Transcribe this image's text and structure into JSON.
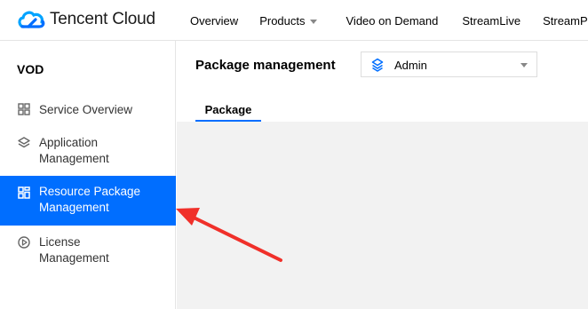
{
  "brand": {
    "name": "Tencent Cloud",
    "accent": "#006eff"
  },
  "nav": {
    "items": [
      "Overview",
      "Products",
      "Video on Demand",
      "StreamLive",
      "StreamPackage"
    ]
  },
  "sidebar": {
    "title": "VOD",
    "items": [
      {
        "lines": [
          "Service Overview"
        ],
        "icon": "grid-icon",
        "active": false
      },
      {
        "lines": [
          "Application",
          "Management"
        ],
        "icon": "layers-icon",
        "active": false
      },
      {
        "lines": [
          "Resource Package",
          "Management"
        ],
        "icon": "package-icon",
        "active": true
      },
      {
        "lines": [
          "License",
          "Management"
        ],
        "icon": "license-icon",
        "active": false
      }
    ]
  },
  "page": {
    "title": "Package management",
    "app_select": {
      "value": "Admin"
    },
    "tabs": [
      "Package"
    ]
  },
  "annotation": {
    "color": "#f0302a"
  }
}
